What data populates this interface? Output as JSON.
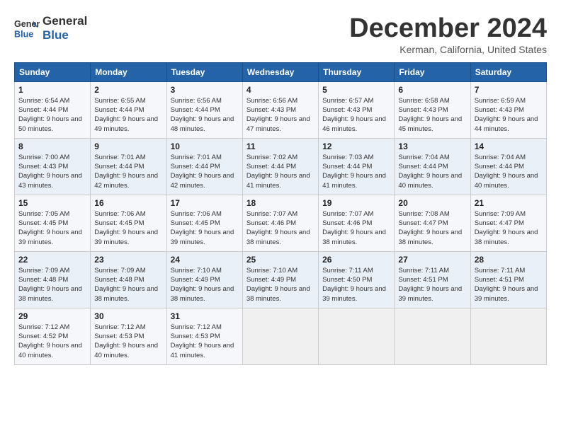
{
  "logo": {
    "line1": "General",
    "line2": "Blue"
  },
  "title": "December 2024",
  "location": "Kerman, California, United States",
  "headers": [
    "Sunday",
    "Monday",
    "Tuesday",
    "Wednesday",
    "Thursday",
    "Friday",
    "Saturday"
  ],
  "weeks": [
    [
      {
        "day": "1",
        "sunrise": "6:54 AM",
        "sunset": "4:44 PM",
        "daylight": "9 hours and 50 minutes."
      },
      {
        "day": "2",
        "sunrise": "6:55 AM",
        "sunset": "4:44 PM",
        "daylight": "9 hours and 49 minutes."
      },
      {
        "day": "3",
        "sunrise": "6:56 AM",
        "sunset": "4:44 PM",
        "daylight": "9 hours and 48 minutes."
      },
      {
        "day": "4",
        "sunrise": "6:56 AM",
        "sunset": "4:43 PM",
        "daylight": "9 hours and 47 minutes."
      },
      {
        "day": "5",
        "sunrise": "6:57 AM",
        "sunset": "4:43 PM",
        "daylight": "9 hours and 46 minutes."
      },
      {
        "day": "6",
        "sunrise": "6:58 AM",
        "sunset": "4:43 PM",
        "daylight": "9 hours and 45 minutes."
      },
      {
        "day": "7",
        "sunrise": "6:59 AM",
        "sunset": "4:43 PM",
        "daylight": "9 hours and 44 minutes."
      }
    ],
    [
      {
        "day": "8",
        "sunrise": "7:00 AM",
        "sunset": "4:43 PM",
        "daylight": "9 hours and 43 minutes."
      },
      {
        "day": "9",
        "sunrise": "7:01 AM",
        "sunset": "4:44 PM",
        "daylight": "9 hours and 42 minutes."
      },
      {
        "day": "10",
        "sunrise": "7:01 AM",
        "sunset": "4:44 PM",
        "daylight": "9 hours and 42 minutes."
      },
      {
        "day": "11",
        "sunrise": "7:02 AM",
        "sunset": "4:44 PM",
        "daylight": "9 hours and 41 minutes."
      },
      {
        "day": "12",
        "sunrise": "7:03 AM",
        "sunset": "4:44 PM",
        "daylight": "9 hours and 41 minutes."
      },
      {
        "day": "13",
        "sunrise": "7:04 AM",
        "sunset": "4:44 PM",
        "daylight": "9 hours and 40 minutes."
      },
      {
        "day": "14",
        "sunrise": "7:04 AM",
        "sunset": "4:44 PM",
        "daylight": "9 hours and 40 minutes."
      }
    ],
    [
      {
        "day": "15",
        "sunrise": "7:05 AM",
        "sunset": "4:45 PM",
        "daylight": "9 hours and 39 minutes."
      },
      {
        "day": "16",
        "sunrise": "7:06 AM",
        "sunset": "4:45 PM",
        "daylight": "9 hours and 39 minutes."
      },
      {
        "day": "17",
        "sunrise": "7:06 AM",
        "sunset": "4:45 PM",
        "daylight": "9 hours and 39 minutes."
      },
      {
        "day": "18",
        "sunrise": "7:07 AM",
        "sunset": "4:46 PM",
        "daylight": "9 hours and 38 minutes."
      },
      {
        "day": "19",
        "sunrise": "7:07 AM",
        "sunset": "4:46 PM",
        "daylight": "9 hours and 38 minutes."
      },
      {
        "day": "20",
        "sunrise": "7:08 AM",
        "sunset": "4:47 PM",
        "daylight": "9 hours and 38 minutes."
      },
      {
        "day": "21",
        "sunrise": "7:09 AM",
        "sunset": "4:47 PM",
        "daylight": "9 hours and 38 minutes."
      }
    ],
    [
      {
        "day": "22",
        "sunrise": "7:09 AM",
        "sunset": "4:48 PM",
        "daylight": "9 hours and 38 minutes."
      },
      {
        "day": "23",
        "sunrise": "7:09 AM",
        "sunset": "4:48 PM",
        "daylight": "9 hours and 38 minutes."
      },
      {
        "day": "24",
        "sunrise": "7:10 AM",
        "sunset": "4:49 PM",
        "daylight": "9 hours and 38 minutes."
      },
      {
        "day": "25",
        "sunrise": "7:10 AM",
        "sunset": "4:49 PM",
        "daylight": "9 hours and 38 minutes."
      },
      {
        "day": "26",
        "sunrise": "7:11 AM",
        "sunset": "4:50 PM",
        "daylight": "9 hours and 39 minutes."
      },
      {
        "day": "27",
        "sunrise": "7:11 AM",
        "sunset": "4:51 PM",
        "daylight": "9 hours and 39 minutes."
      },
      {
        "day": "28",
        "sunrise": "7:11 AM",
        "sunset": "4:51 PM",
        "daylight": "9 hours and 39 minutes."
      }
    ],
    [
      {
        "day": "29",
        "sunrise": "7:12 AM",
        "sunset": "4:52 PM",
        "daylight": "9 hours and 40 minutes."
      },
      {
        "day": "30",
        "sunrise": "7:12 AM",
        "sunset": "4:53 PM",
        "daylight": "9 hours and 40 minutes."
      },
      {
        "day": "31",
        "sunrise": "7:12 AM",
        "sunset": "4:53 PM",
        "daylight": "9 hours and 41 minutes."
      },
      null,
      null,
      null,
      null
    ]
  ],
  "labels": {
    "sunrise_prefix": "Sunrise: ",
    "sunset_prefix": "Sunset: ",
    "daylight_prefix": "Daylight: "
  }
}
